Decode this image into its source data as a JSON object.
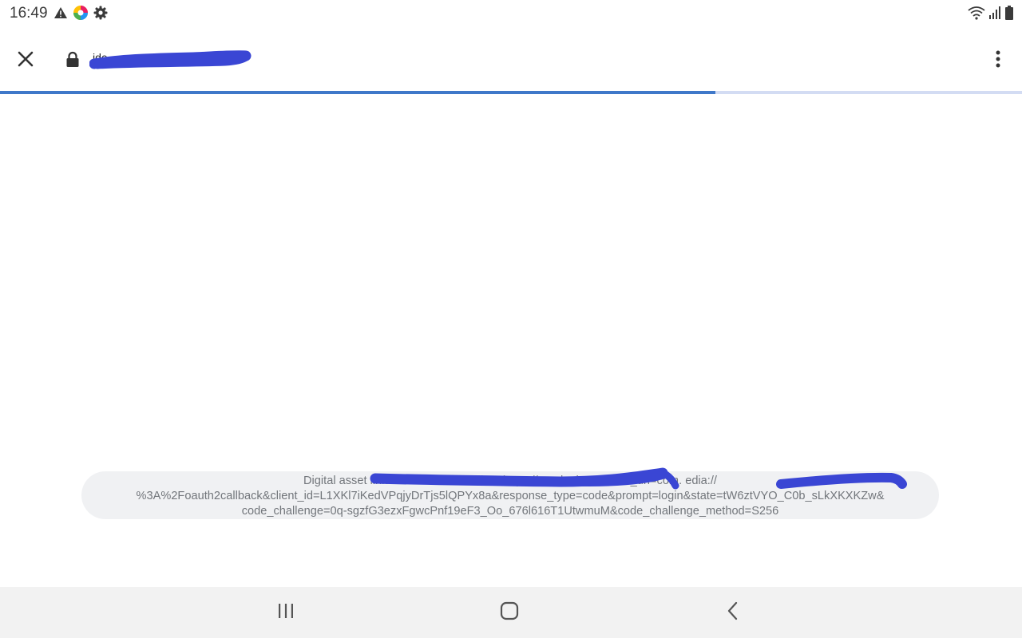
{
  "status_bar": {
    "time": "16:49",
    "left_icons": [
      "warning-icon",
      "colorful-app-icon",
      "settings-gear-icon"
    ],
    "right_icons": [
      "wifi-icon",
      "cellular-signal-icon",
      "battery-icon"
    ]
  },
  "toolbar": {
    "close_icon": "close-icon",
    "lock_icon": "lock-icon",
    "url_visible": "ide",
    "menu_icon": "more-vert-icon"
  },
  "page_load_progress": 0.7,
  "toast": {
    "line1": "Digital asset links verification failed on https://ap                                                                     _login?redirect_uri=com.                                  edia://",
    "line2": "%3A%2Foauth2callback&client_id=L1XKl7iKedVPqjyDrTjs5lQPYx8a&response_type=code&prompt=login&state=tW6ztVYO_C0b_sLkXKXKZw&",
    "line3": "code_challenge=0q-sgzfG3ezxFgwcPnf19eF3_Oo_676l616T1UtwmuM&code_challenge_method=S256"
  },
  "nav_bar": {
    "recents_icon": "recents-icon",
    "home_icon": "home-icon",
    "back_icon": "back-icon"
  },
  "colors": {
    "redaction": "#3a46d4",
    "progress": "#3f78c9",
    "progress_track": "#d3dcf3",
    "toast_bg": "#f0f1f3",
    "nav_bg": "#f2f2f2"
  }
}
